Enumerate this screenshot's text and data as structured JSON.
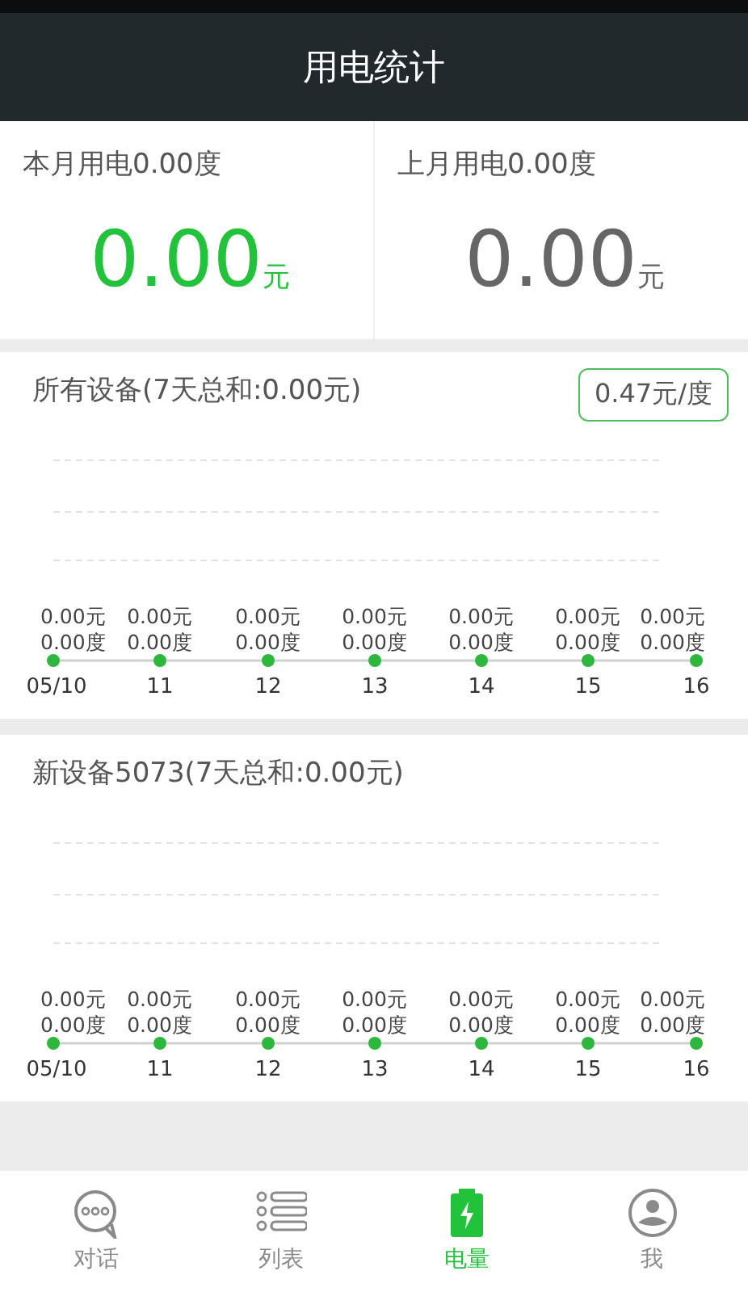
{
  "header": {
    "title": "用电统计"
  },
  "summary": [
    {
      "label": "本月用电0.00度",
      "amount": "0.00",
      "unit": "元",
      "highlighted": true
    },
    {
      "label": "上月用电0.00度",
      "amount": "0.00",
      "unit": "元",
      "highlighted": false
    }
  ],
  "devices": [
    {
      "title": "所有设备(7天总和:0.00元)",
      "rate_badge": "0.47元/度",
      "days": [
        {
          "date": "05/10",
          "cost": "0.00元",
          "energy": "0.00度"
        },
        {
          "date": "11",
          "cost": "0.00元",
          "energy": "0.00度"
        },
        {
          "date": "12",
          "cost": "0.00元",
          "energy": "0.00度"
        },
        {
          "date": "13",
          "cost": "0.00元",
          "energy": "0.00度"
        },
        {
          "date": "14",
          "cost": "0.00元",
          "energy": "0.00度"
        },
        {
          "date": "15",
          "cost": "0.00元",
          "energy": "0.00度"
        },
        {
          "date": "16",
          "cost": "0.00元",
          "energy": "0.00度"
        }
      ]
    },
    {
      "title": "新设备5073(7天总和:0.00元)",
      "days": [
        {
          "date": "05/10",
          "cost": "0.00元",
          "energy": "0.00度"
        },
        {
          "date": "11",
          "cost": "0.00元",
          "energy": "0.00度"
        },
        {
          "date": "12",
          "cost": "0.00元",
          "energy": "0.00度"
        },
        {
          "date": "13",
          "cost": "0.00元",
          "energy": "0.00度"
        },
        {
          "date": "14",
          "cost": "0.00元",
          "energy": "0.00度"
        },
        {
          "date": "15",
          "cost": "0.00元",
          "energy": "0.00度"
        },
        {
          "date": "16",
          "cost": "0.00元",
          "energy": "0.00度"
        }
      ]
    }
  ],
  "tabs": [
    {
      "kind": "chat",
      "label": "对话",
      "selected": false
    },
    {
      "kind": "list",
      "label": "列表",
      "selected": false
    },
    {
      "kind": "battery",
      "label": "电量",
      "selected": true
    },
    {
      "kind": "profile",
      "label": "我",
      "selected": false
    }
  ]
}
